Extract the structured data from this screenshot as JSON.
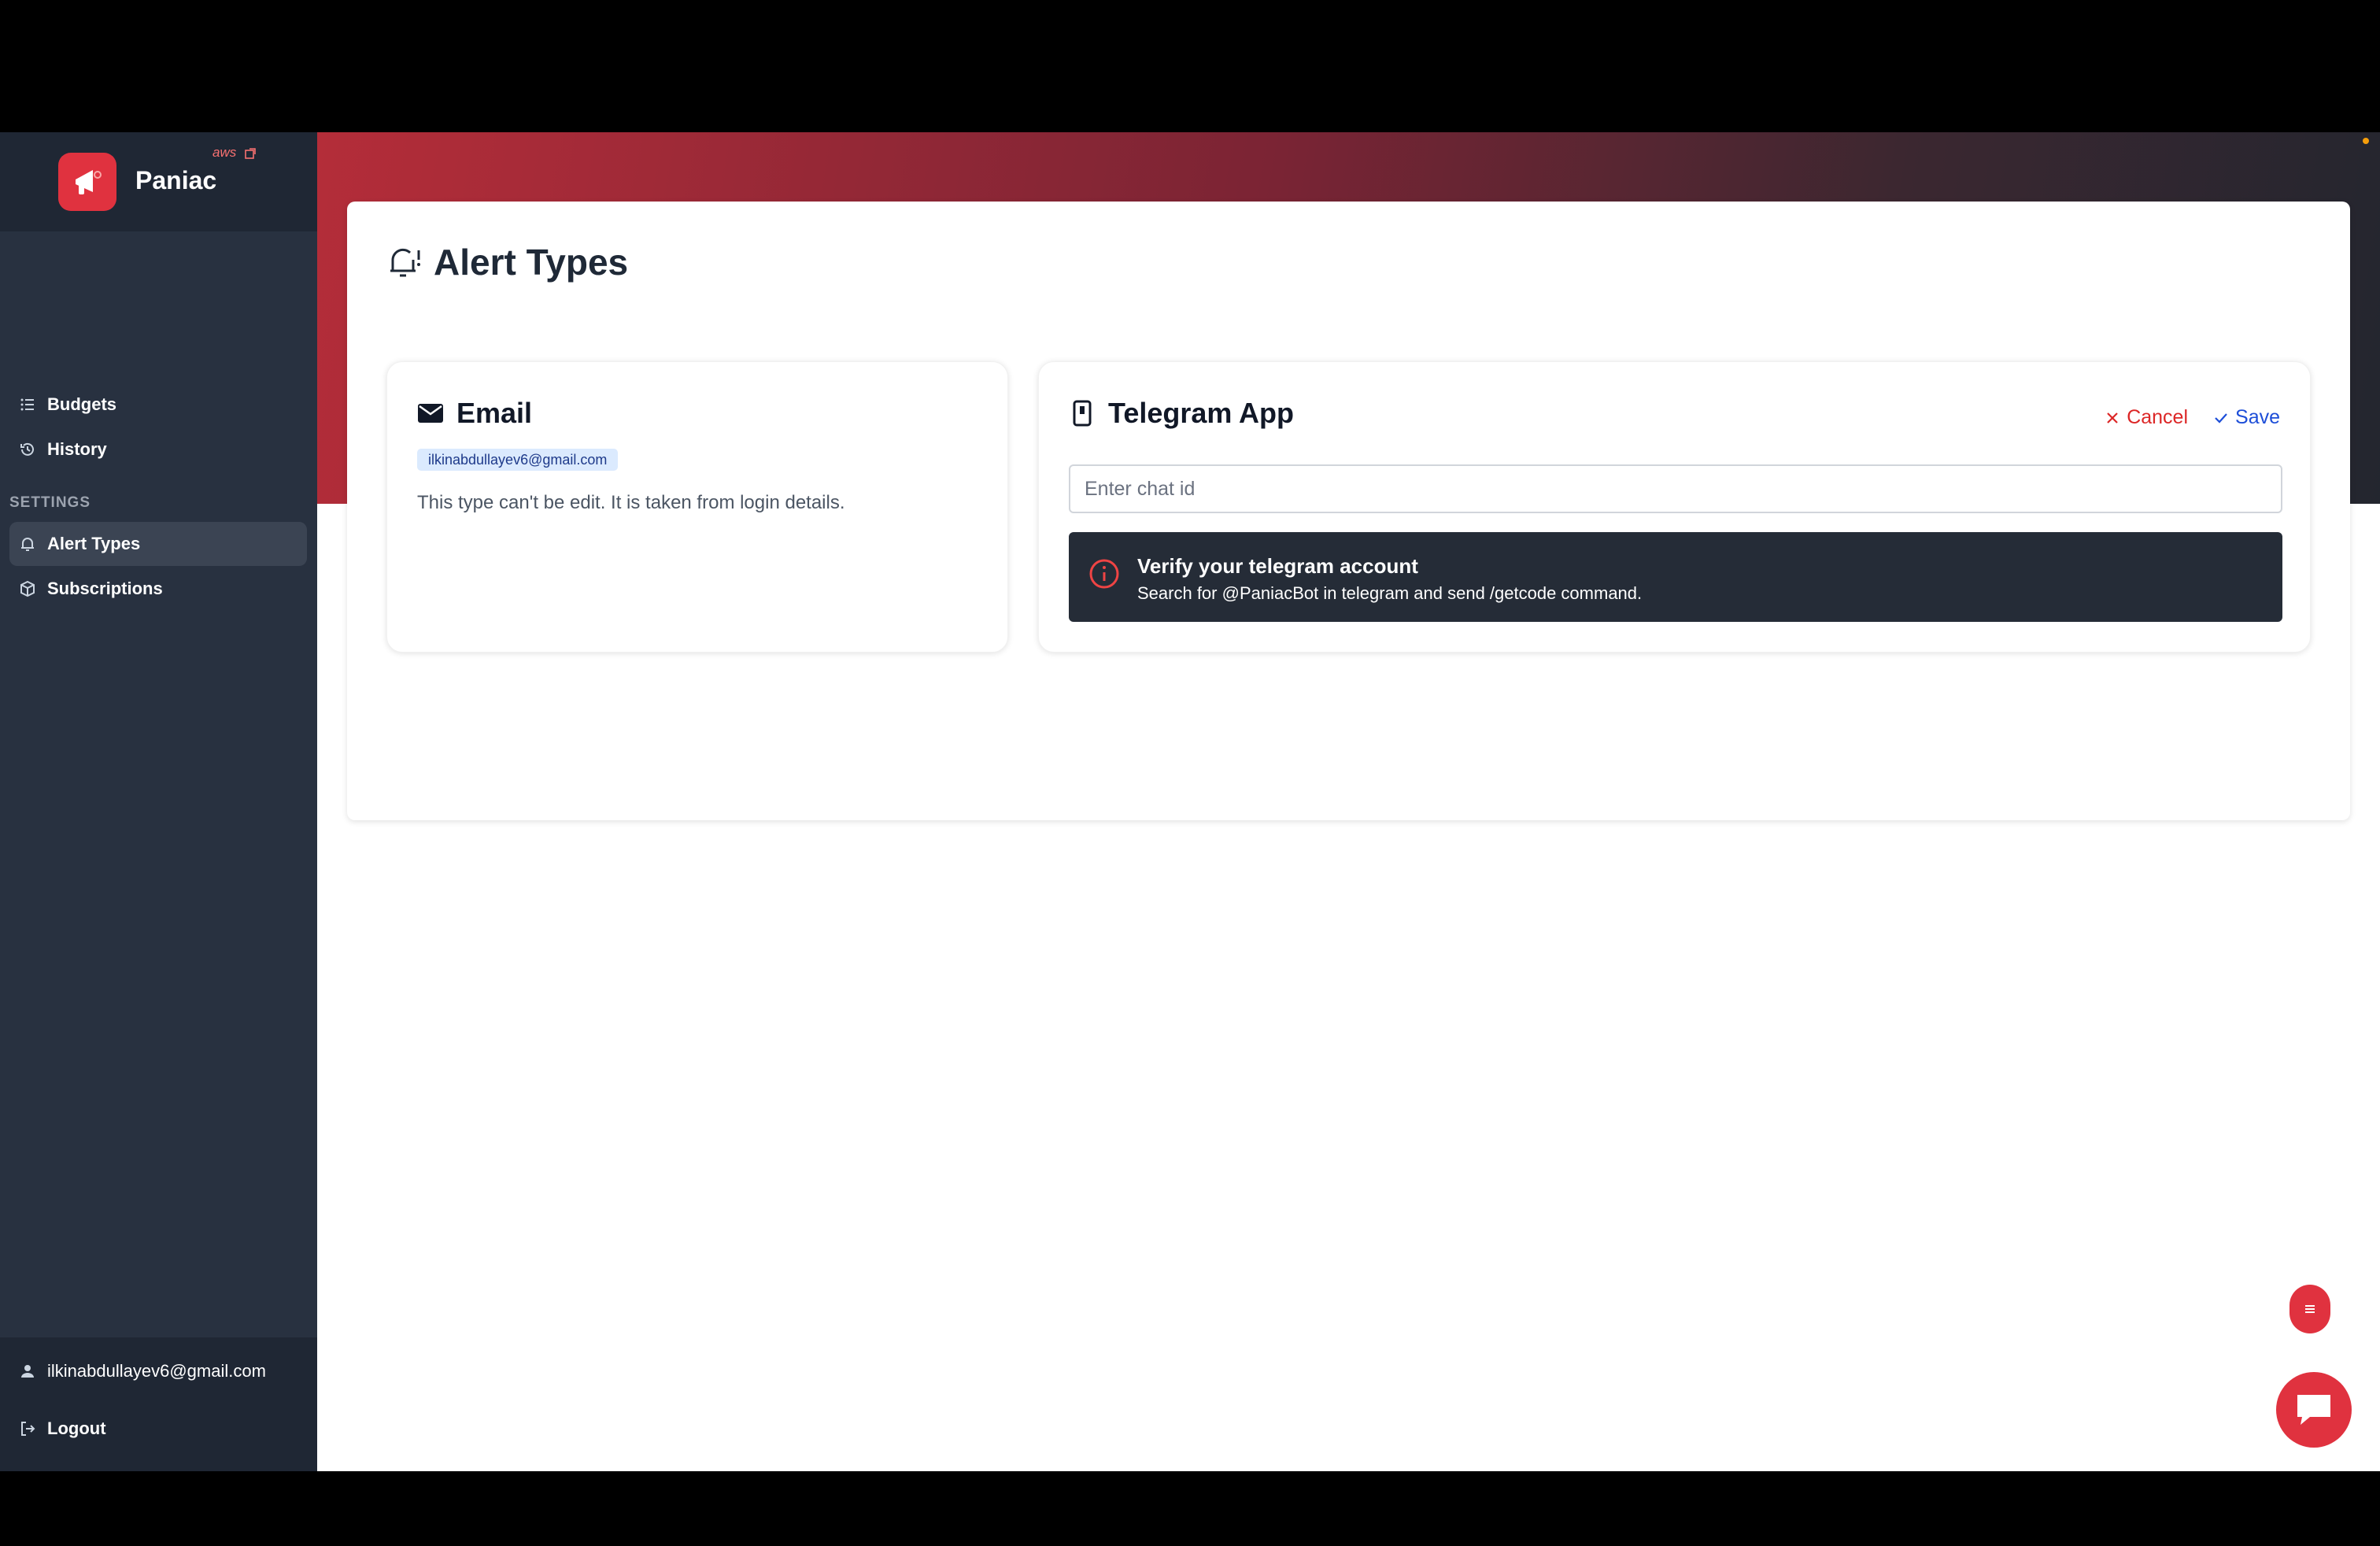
{
  "brand": {
    "name": "Paniac",
    "badge": "aws",
    "logo_color": "#e0323f"
  },
  "sidebar": {
    "items": [
      {
        "label": "Budgets",
        "icon": "list-icon"
      },
      {
        "label": "History",
        "icon": "history-icon"
      }
    ],
    "section_label": "SETTINGS",
    "settings_items": [
      {
        "label": "Alert Types",
        "icon": "bell-icon",
        "active": true
      },
      {
        "label": "Subscriptions",
        "icon": "box-icon",
        "active": false
      }
    ],
    "footer": {
      "user_email": "ilkinabdullayev6@gmail.com",
      "logout_label": "Logout"
    }
  },
  "page": {
    "title": "Alert Types",
    "title_icon": "bell-alert-icon"
  },
  "email_card": {
    "title": "Email",
    "icon": "envelope-icon",
    "badge": "ilkinabdullayev6@gmail.com",
    "note": "This type can't be edit. It is taken from login details."
  },
  "telegram_card": {
    "title": "Telegram App",
    "icon": "mobile-icon",
    "cancel_label": "Cancel",
    "save_label": "Save",
    "chat_input": {
      "value": "",
      "placeholder": "Enter chat id"
    },
    "alert": {
      "title": "Verify your telegram account",
      "text": "Search for @PaniacBot in telegram and send /getcode command.",
      "icon": "info-circle-icon"
    }
  },
  "colors": {
    "accent": "#e0323f",
    "sidebar": "#283140",
    "cancel": "#dc2626",
    "save": "#1d4ed8"
  }
}
